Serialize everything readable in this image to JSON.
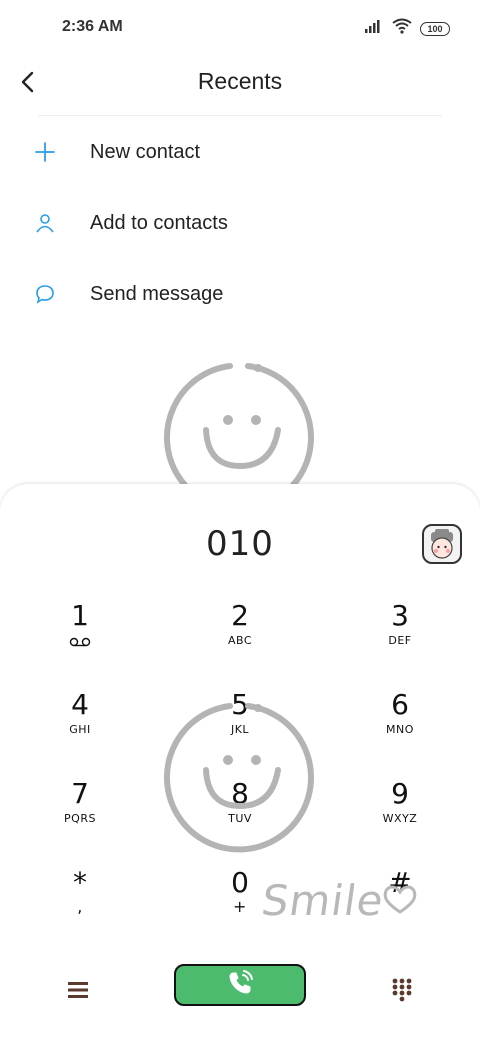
{
  "status_bar": {
    "time": "2:36 AM",
    "battery": "100",
    "icons": [
      "signal-icon",
      "wifi-icon",
      "battery-icon"
    ]
  },
  "header": {
    "title": "Recents",
    "back_icon": "back-arrow-icon"
  },
  "actions": [
    {
      "label": "New contact",
      "icon": "plus-icon"
    },
    {
      "label": "Add to contacts",
      "icon": "person-icon"
    },
    {
      "label": "Send message",
      "icon": "chat-bubble-icon"
    }
  ],
  "dialer": {
    "number": "010",
    "keys": [
      {
        "digit": "1",
        "letters": "voicemail"
      },
      {
        "digit": "2",
        "letters": "ABC"
      },
      {
        "digit": "3",
        "letters": "DEF"
      },
      {
        "digit": "4",
        "letters": "GHI"
      },
      {
        "digit": "5",
        "letters": "JKL"
      },
      {
        "digit": "6",
        "letters": "MNO"
      },
      {
        "digit": "7",
        "letters": "PQRS"
      },
      {
        "digit": "8",
        "letters": "TUV"
      },
      {
        "digit": "9",
        "letters": "WXYZ"
      },
      {
        "digit": "*",
        "letters": ","
      },
      {
        "digit": "0",
        "letters": "+"
      },
      {
        "digit": "#",
        "letters": ""
      }
    ],
    "decoration_text": "Smile"
  },
  "bottom_bar": {
    "menu_icon": "menu-icon",
    "call_icon": "phone-call-icon",
    "keypad_icon": "dialpad-icon"
  },
  "colors": {
    "accent": "#2a9de8",
    "call_green": "#4cbb6e",
    "dark_brown": "#5a3a2c"
  }
}
